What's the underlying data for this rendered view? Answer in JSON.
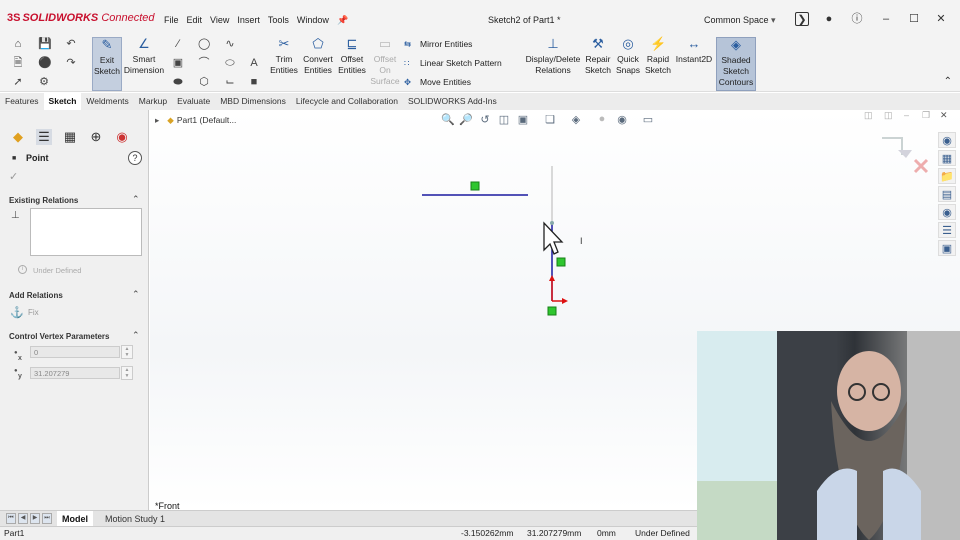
{
  "app": {
    "logo_ds": "3S",
    "logo_solid": "SOLID",
    "logo_works": "WORKS",
    "logo_connected": "Connected",
    "menus": [
      "File",
      "Edit",
      "View",
      "Insert",
      "Tools",
      "Window"
    ],
    "doc_title": "Sketch2 of Part1 *",
    "space": "Common Space"
  },
  "ribbon": {
    "exit_sketch": "Exit Sketch",
    "smart_dimension": "Smart Dimension",
    "trim_entities": "Trim Entities",
    "convert_entities": "Convert Entities",
    "offset_entities": "Offset Entities",
    "offset_on_surface": "Offset On Surface",
    "mirror_entities": "Mirror Entities",
    "linear_sketch_pattern": "Linear Sketch Pattern",
    "move_entities": "Move Entities",
    "display_delete_relations": "Display/Delete Relations",
    "repair_sketch": "Repair Sketch",
    "quick_snaps": "Quick Snaps",
    "rapid_sketch": "Rapid Sketch",
    "instant2d": "Instant2D",
    "shaded_sketch_contours": "Shaded Sketch Contours"
  },
  "tabs": [
    "Features",
    "Sketch",
    "Weldments",
    "Markup",
    "Evaluate",
    "MBD Dimensions",
    "Lifecycle and Collaboration",
    "SOLIDWORKS Add-Ins"
  ],
  "active_tab": "Sketch",
  "property_manager": {
    "title": "Point",
    "existing_relations": "Existing Relations",
    "status": "Under Defined",
    "add_relations": "Add Relations",
    "fix": "Fix",
    "control_vertex": "Control Vertex Parameters",
    "x_label": "x",
    "y_label": "y",
    "x_value": "0",
    "y_value": "31.207279"
  },
  "graphics": {
    "tree_root": "Part1 (Default...",
    "view_label": "*Front"
  },
  "bottom_tabs": [
    "Model",
    "Motion Study 1"
  ],
  "status_bar": {
    "doc": "Part1",
    "x": "-3.150262mm",
    "y": "31.207279mm",
    "z": "0mm",
    "state": "Under Defined"
  }
}
